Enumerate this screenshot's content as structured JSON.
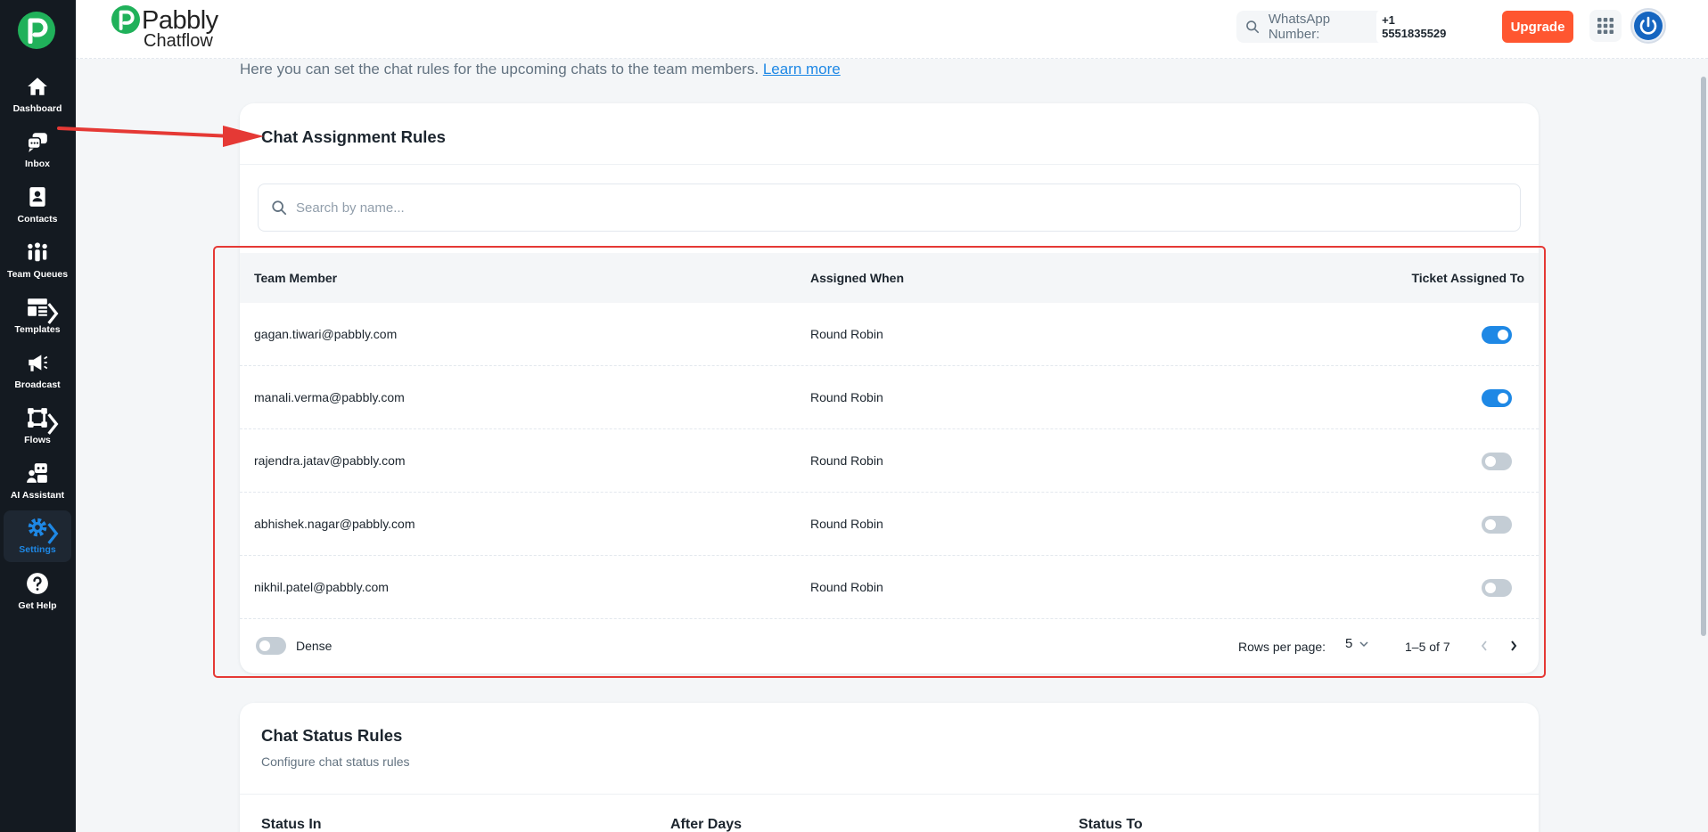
{
  "sidebar": {
    "items": [
      {
        "label": "Dashboard",
        "icon": "home-icon"
      },
      {
        "label": "Inbox",
        "icon": "chat-bubbles-icon"
      },
      {
        "label": "Contacts",
        "icon": "contact-book-icon"
      },
      {
        "label": "Team Queues",
        "icon": "team-icon"
      },
      {
        "label": "Templates",
        "icon": "templates-icon"
      },
      {
        "label": "Broadcast",
        "icon": "megaphone-icon"
      },
      {
        "label": "Flows",
        "icon": "flows-icon"
      },
      {
        "label": "AI Assistant",
        "icon": "ai-assistant-icon"
      },
      {
        "label": "Settings",
        "icon": "gear-icon"
      },
      {
        "label": "Get Help",
        "icon": "help-icon"
      }
    ],
    "active": "Settings"
  },
  "header": {
    "brand_name": "Pabbly",
    "brand_sub": "Chatflow",
    "whatsapp_label": "WhatsApp Number:",
    "whatsapp_number": "+1 5551835529",
    "upgrade_label": "Upgrade"
  },
  "main": {
    "subtitle": "Here you can set the chat rules for the upcoming chats to the team members.",
    "learn_more": "Learn more"
  },
  "assignment": {
    "title": "Chat Assignment Rules",
    "search_placeholder": "Search by name...",
    "columns": [
      "Team Member",
      "Assigned When",
      "Ticket Assigned To"
    ],
    "rows": [
      {
        "member": "gagan.tiwari@pabbly.com",
        "when": "Round Robin",
        "enabled": true
      },
      {
        "member": "manali.verma@pabbly.com",
        "when": "Round Robin",
        "enabled": true
      },
      {
        "member": "rajendra.jatav@pabbly.com",
        "when": "Round Robin",
        "enabled": false
      },
      {
        "member": "abhishek.nagar@pabbly.com",
        "when": "Round Robin",
        "enabled": false
      },
      {
        "member": "nikhil.patel@pabbly.com",
        "when": "Round Robin",
        "enabled": false
      }
    ],
    "footer": {
      "dense_label": "Dense",
      "rows_per_page_label": "Rows per page:",
      "rows_per_page": "5",
      "page_info": "1–5 of 7"
    }
  },
  "status_rules": {
    "title": "Chat Status Rules",
    "subtitle": "Configure chat status rules",
    "columns": [
      "Status In",
      "After Days",
      "Status To"
    ]
  },
  "colors": {
    "sidebar_bg": "#141a21",
    "accent": "#1e88e5",
    "upgrade": "#ff5630",
    "brand_green": "#20b15a",
    "annotation_red": "#e53935"
  }
}
